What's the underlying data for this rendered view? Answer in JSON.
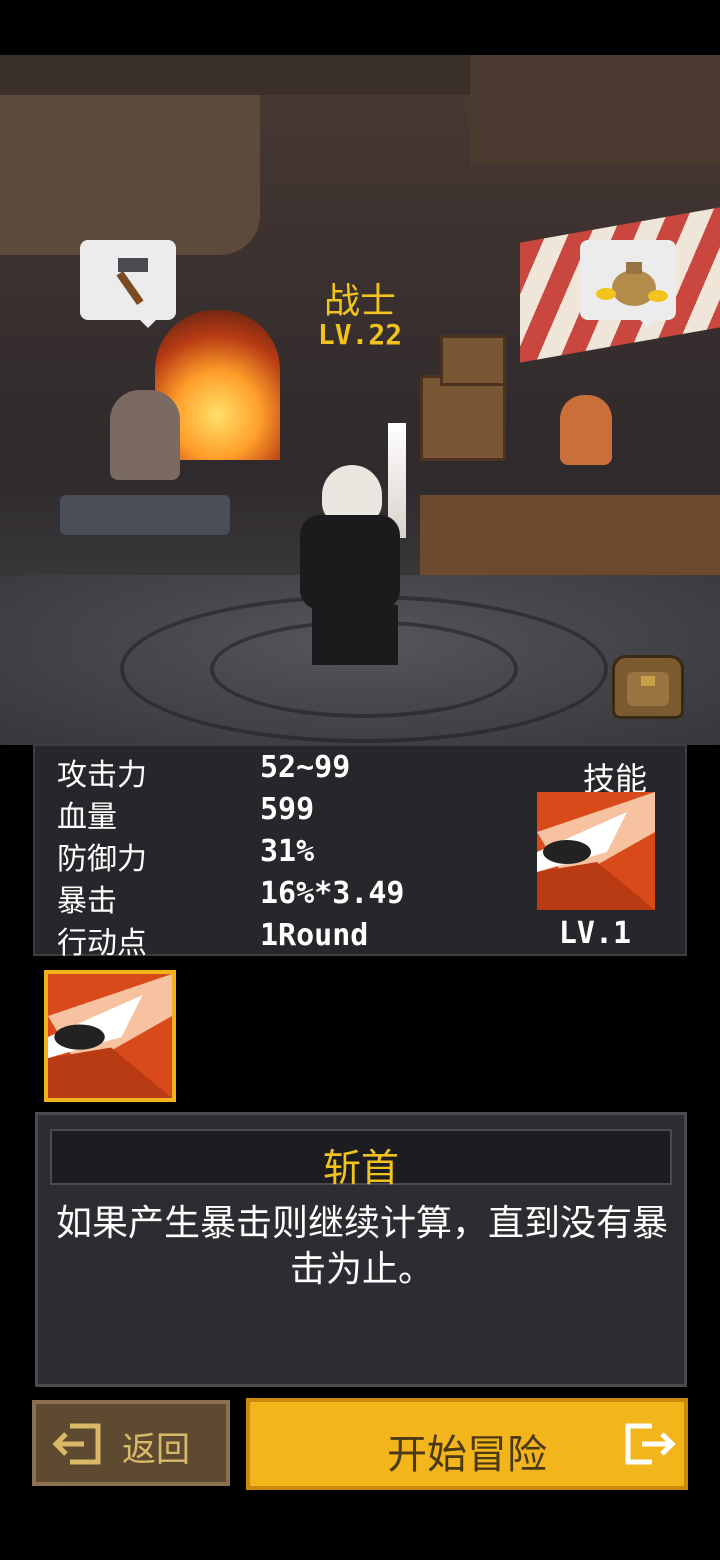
{
  "hero": {
    "name": "战士",
    "level": "LV.22"
  },
  "stats": [
    {
      "label": "攻击力",
      "value": "52~99"
    },
    {
      "label": "血量",
      "value": "599"
    },
    {
      "label": "防御力",
      "value": "31%"
    },
    {
      "label": "暴击",
      "value": "16%*3.49"
    },
    {
      "label": "行动点",
      "value": "1Round"
    }
  ],
  "skill": {
    "header": "技能",
    "level": "LV.1",
    "icon": "blade-slash-icon"
  },
  "description": {
    "title": "斩首",
    "text": "如果产生暴击则继续计算，直到没有暴击为止。"
  },
  "buttons": {
    "back": "返回",
    "start": "开始冒险"
  },
  "icons": {
    "blacksmith_bubble": "hammer-icon",
    "merchant_bubble": "coin-bag-icon",
    "bag": "backpack-icon",
    "back": "exit-left-icon",
    "start": "exit-right-icon"
  },
  "colors": {
    "accent": "#f2b51c",
    "gold_text": "#f2c31c",
    "panel_bg": "#27272b"
  }
}
